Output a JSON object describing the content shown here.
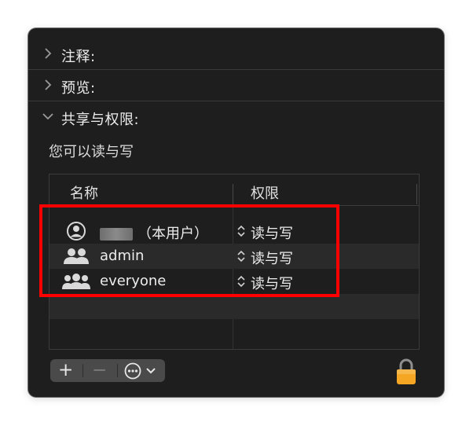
{
  "sections": [
    {
      "label": "注释:",
      "expanded": false
    },
    {
      "label": "预览:",
      "expanded": false
    },
    {
      "label": "共享与权限:",
      "expanded": true
    }
  ],
  "permission_note": "您可以读与写",
  "table": {
    "headers": {
      "name": "名称",
      "permission": "权限"
    },
    "rows": [
      {
        "name": "（本用户）",
        "permission": "读与写",
        "icon": "user-circle-icon"
      },
      {
        "name": "admin",
        "permission": "读与写",
        "icon": "group-icon"
      },
      {
        "name": "everyone",
        "permission": "读与写",
        "icon": "everyone-icon"
      }
    ]
  },
  "toolbar": {
    "add_label": "+",
    "remove_label": "−",
    "more_icon": "ellipsis-circle-icon",
    "lock_icon": "lock-icon"
  },
  "colors": {
    "panel_bg": "#1e1e1e",
    "highlight_box": "#ff0000",
    "lock": "#f5a623"
  }
}
